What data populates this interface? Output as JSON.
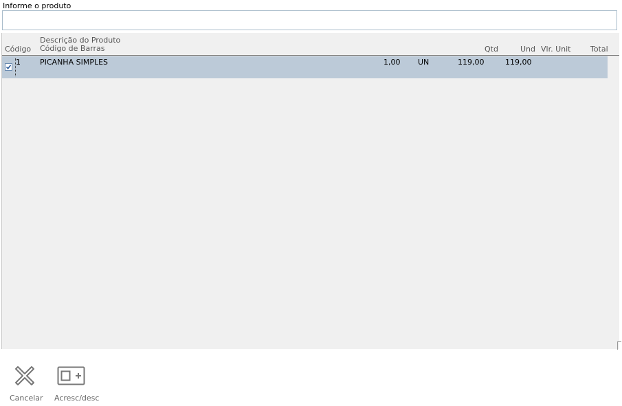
{
  "search": {
    "label": "Informe o produto",
    "value": "",
    "placeholder": ""
  },
  "grid": {
    "headers": {
      "codigo": "Código",
      "descricao": "Descrição do Produto",
      "barras": "Código de Barras",
      "qtd": "Qtd",
      "und": "Und",
      "vlr_unit": "Vlr. Unit",
      "total": "Total"
    },
    "rows": [
      {
        "checked": true,
        "codigo": "1",
        "descricao": "PICANHA SIMPLES",
        "qtd": "1,00",
        "und": "UN",
        "vlr_unit": "119,00",
        "total": "119,00"
      }
    ]
  },
  "toolbar": {
    "cancel_label": "Cancelar",
    "cancel_icon": "close-x-icon",
    "acresc_label": "Acresc/desc",
    "acresc_icon": "square-plus-icon",
    "icon_color": "#777777"
  },
  "colors": {
    "row_selected": "#bccad8",
    "grid_bg": "#f0f0f0",
    "input_border": "#a9bccb"
  }
}
